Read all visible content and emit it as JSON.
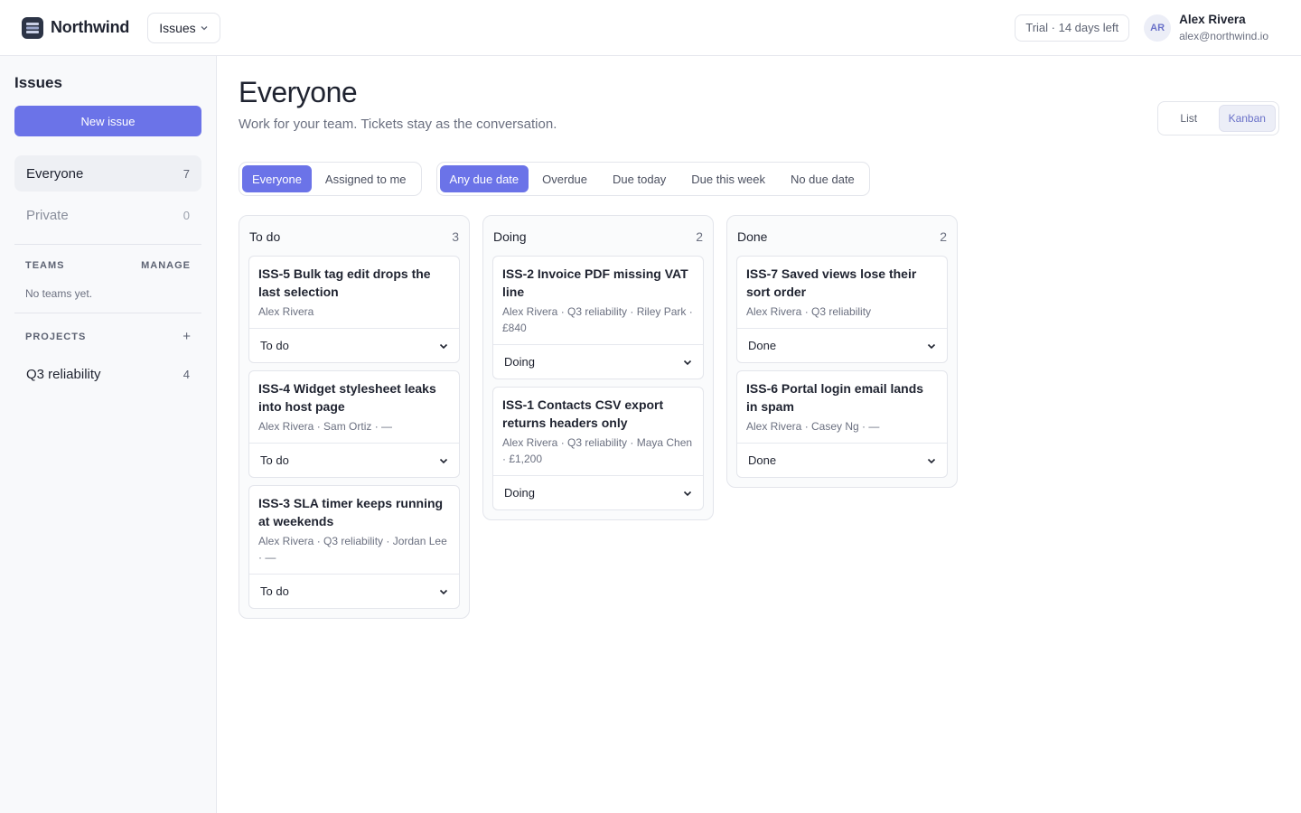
{
  "brand": {
    "name": "Northwind"
  },
  "app_switcher": {
    "label": "Issues"
  },
  "trial": {
    "label": "Trial · 14 days left"
  },
  "user": {
    "initials": "AR",
    "name": "Alex Rivera",
    "email": "alex@northwind.io"
  },
  "sidebar": {
    "title": "Issues",
    "new_issue_label": "New issue",
    "items": [
      {
        "label": "Everyone",
        "count": "7",
        "active": true
      },
      {
        "label": "Private",
        "count": "0",
        "active": false
      }
    ],
    "teams": {
      "heading": "TEAMS",
      "action": "MANAGE",
      "empty": "No teams yet."
    },
    "projects": {
      "heading": "PROJECTS",
      "action": "+",
      "items": [
        {
          "label": "Q3 reliability",
          "count": "4"
        }
      ]
    }
  },
  "page": {
    "title": "Everyone",
    "subtitle": "Work for your team. Tickets stay as the conversation."
  },
  "view_toggle": {
    "options": [
      "List",
      "Kanban"
    ],
    "selected": "Kanban"
  },
  "filters": {
    "scope": {
      "options": [
        "Everyone",
        "Assigned to me"
      ],
      "selected": "Everyone"
    },
    "due": {
      "options": [
        "Any due date",
        "Overdue",
        "Due today",
        "Due this week",
        "No due date"
      ],
      "selected": "Any due date"
    }
  },
  "columns": [
    {
      "name": "To do",
      "count": "3",
      "cards": [
        {
          "title": "ISS-5 Bulk tag edit drops the last selection",
          "meta": "Alex Rivera",
          "status": "To do"
        },
        {
          "title": "ISS-4 Widget stylesheet leaks into host page",
          "meta": "Alex Rivera · Sam Ortiz · —",
          "status": "To do"
        },
        {
          "title": "ISS-3 SLA timer keeps running at weekends",
          "meta": "Alex Rivera · Q3 reliability · Jordan Lee · —",
          "status": "To do"
        }
      ]
    },
    {
      "name": "Doing",
      "count": "2",
      "cards": [
        {
          "title": "ISS-2 Invoice PDF missing VAT line",
          "meta": "Alex Rivera · Q3 reliability · Riley Park · £840",
          "status": "Doing"
        },
        {
          "title": "ISS-1 Contacts CSV export returns headers only",
          "meta": "Alex Rivera · Q3 reliability · Maya Chen · £1,200",
          "status": "Doing"
        }
      ]
    },
    {
      "name": "Done",
      "count": "2",
      "cards": [
        {
          "title": "ISS-7 Saved views lose their sort order",
          "meta": "Alex Rivera · Q3 reliability",
          "status": "Done"
        },
        {
          "title": "ISS-6 Portal login email lands in spam",
          "meta": "Alex Rivera · Casey Ng · —",
          "status": "Done"
        }
      ]
    }
  ],
  "icons": {
    "logo": "stack-logo-icon",
    "app_switcher": "chevron-down-icon",
    "status": "chevron-down-icon",
    "project_add": "plus-icon"
  },
  "colors": {
    "accent": "#6b73e8",
    "logo": "#2c3446",
    "avatar_bg": "#eceef7",
    "avatar_text": "#6b72c9"
  }
}
